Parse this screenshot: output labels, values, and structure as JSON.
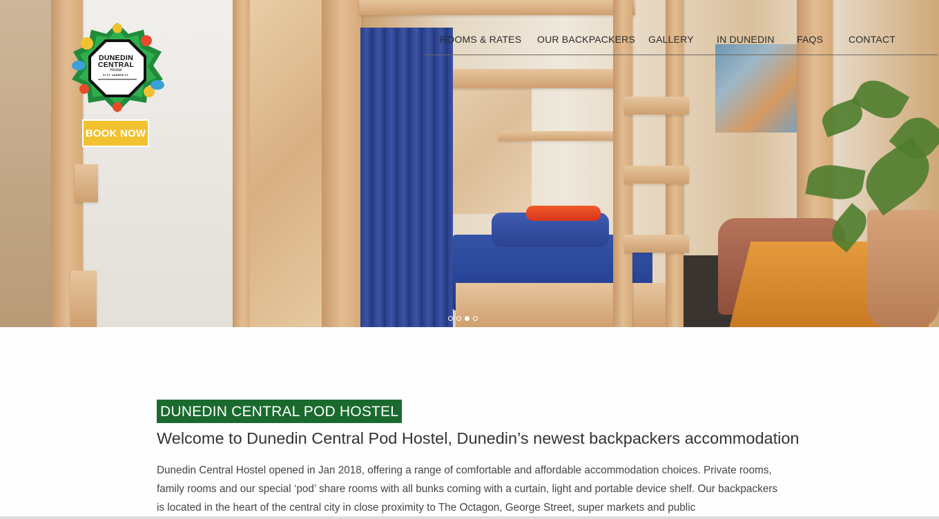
{
  "brand": {
    "logo_line1": "DUNEDIN",
    "logo_line2": "CENTRAL",
    "logo_line3": "Hostel",
    "logo_line4": "91 ST. ANDREW ST."
  },
  "nav": {
    "items": [
      {
        "label": "ROOMS & RATES"
      },
      {
        "label": "OUR BACKPACKERS"
      },
      {
        "label": "GALLERY"
      },
      {
        "label": "IN DUNEDIN"
      },
      {
        "label": "FAQS"
      },
      {
        "label": "CONTACT"
      }
    ]
  },
  "hero": {
    "book_label": "BOOK NOW",
    "slide_count": 4,
    "active_slide": 3
  },
  "content": {
    "badge": "DUNEDIN CENTRAL POD HOSTEL",
    "headline": "Welcome to Dunedin Central Pod Hostel, Dunedin’s newest backpackers accommodation",
    "paragraph": "Dunedin Central Hostel opened in Jan 2018, offering a range of comfortable and affordable accommodation choices. Private rooms, family rooms and our special ‘pod’ share rooms with all bunks coming with a curtain, light and portable device shelf.  Our backpackers is located in the heart of the central city in close proximity to The Octagon, George Street, super markets and public"
  },
  "colors": {
    "badge_bg": "#1a6a2e",
    "book_bg": "#f2c12f"
  }
}
